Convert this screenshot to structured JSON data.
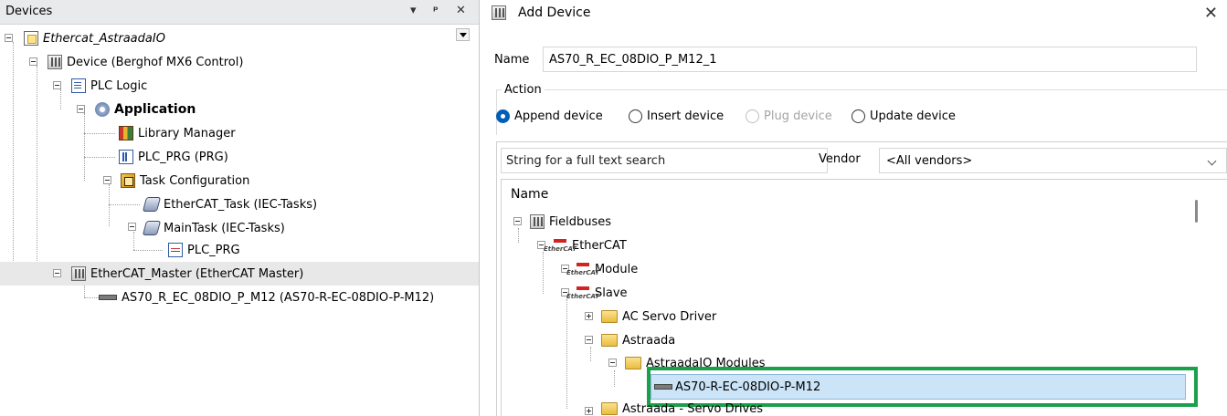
{
  "devices_pane": {
    "title": "Devices",
    "buttons": {
      "dropdown": "▾",
      "pin": "ᵖ",
      "close": "✕"
    },
    "tree": [
      {
        "label": "Ethercat_AstraadaIO",
        "icon": "project-icon",
        "italic": true
      },
      {
        "label": "Device (Berghof MX6 Control)",
        "icon": "device-icon"
      },
      {
        "label": "PLC Logic",
        "icon": "plc-logic-icon"
      },
      {
        "label": "Application",
        "icon": "application-icon",
        "bold": true
      },
      {
        "label": "Library Manager",
        "icon": "library-manager-icon"
      },
      {
        "label": "PLC_PRG (PRG)",
        "icon": "program-icon"
      },
      {
        "label": "Task Configuration",
        "icon": "task-configuration-icon"
      },
      {
        "label": "EtherCAT_Task (IEC-Tasks)",
        "icon": "task-icon"
      },
      {
        "label": "MainTask (IEC-Tasks)",
        "icon": "task-icon"
      },
      {
        "label": "PLC_PRG",
        "icon": "program-call-icon"
      },
      {
        "label": "EtherCAT_Master (EtherCAT Master)",
        "icon": "device-icon",
        "selected_row": true
      },
      {
        "label": "AS70_R_EC_08DIO_P_M12 (AS70-R-EC-08DIO-P-M12)",
        "icon": "slave-module-icon"
      }
    ]
  },
  "dialog": {
    "title": "Add Device",
    "close": "✕",
    "name_label": "Name",
    "name_value": "AS70_R_EC_08DIO_P_M12_1",
    "action_label": "Action",
    "actions": [
      {
        "label": "Append device",
        "checked": true,
        "enabled": true
      },
      {
        "label": "Insert device",
        "checked": false,
        "enabled": true
      },
      {
        "label": "Plug device",
        "checked": false,
        "enabled": false
      },
      {
        "label": "Update device",
        "checked": false,
        "enabled": true
      }
    ],
    "search_placeholder": "String for a full text search",
    "vendor_label": "Vendor",
    "vendor_value": "<All vendors>",
    "tree_header": "Name",
    "catalog": [
      {
        "label": "Fieldbuses"
      },
      {
        "label": "EtherCAT"
      },
      {
        "label": "Module"
      },
      {
        "label": "Slave"
      },
      {
        "label": "AC Servo Driver"
      },
      {
        "label": "Astraada"
      },
      {
        "label": "AstraadaIO Modules"
      },
      {
        "label": "AS70-R-EC-08DIO-P-M12",
        "selected": true
      },
      {
        "label": "Astraada - Servo Drives"
      }
    ]
  },
  "colors": {
    "selection": "#cce4f7",
    "highlight_frame": "#1aa04a",
    "radio_checked": "#005fb8"
  }
}
